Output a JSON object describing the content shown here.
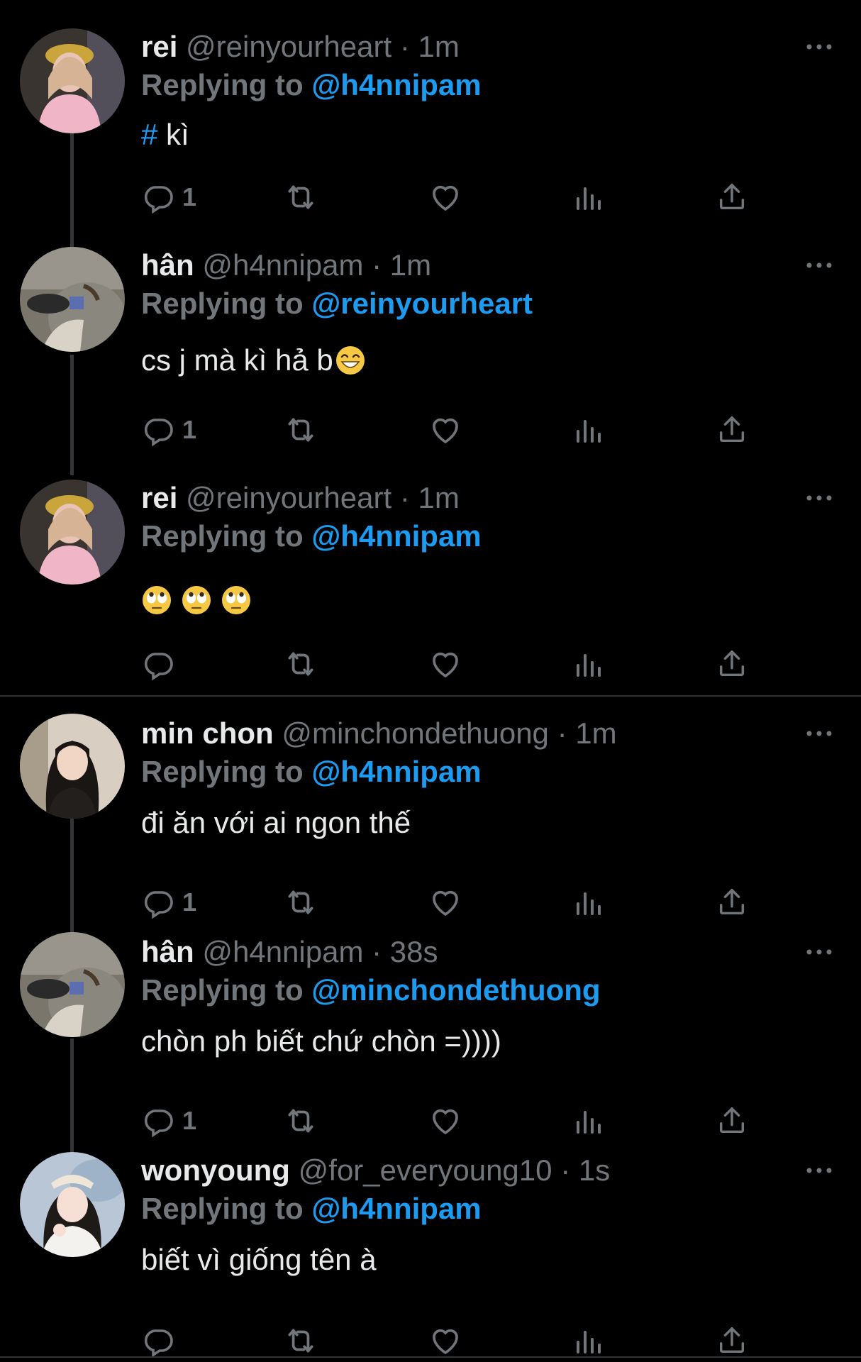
{
  "tweets": [
    {
      "name": "rei",
      "handle": "@reinyourheart",
      "time": "1m",
      "reply_prefix": "Replying to",
      "reply_to": "@h4nnipam",
      "hashtag": "#",
      "text": "kì",
      "reply_count": "1",
      "avatar": "rei-avatar"
    },
    {
      "name": "hân",
      "handle": "@h4nnipam",
      "time": "1m",
      "reply_prefix": "Replying to",
      "reply_to": "@reinyourheart",
      "text": "cs j mà kì hả b",
      "reply_count": "1",
      "avatar": "han-avatar",
      "emoji": "grinning-face"
    },
    {
      "name": "rei",
      "handle": "@reinyourheart",
      "time": "1m",
      "reply_prefix": "Replying to",
      "reply_to": "@h4nnipam",
      "text": "",
      "reply_count": "",
      "avatar": "rei-avatar",
      "emoji": "rolling-eyes x3"
    },
    {
      "name": "min chon",
      "handle": "@minchondethuong",
      "time": "1m",
      "reply_prefix": "Replying to",
      "reply_to": "@h4nnipam",
      "text": "đi ăn với ai ngon thế",
      "reply_count": "1",
      "avatar": "minchon-avatar"
    },
    {
      "name": "hân",
      "handle": "@h4nnipam",
      "time": "38s",
      "reply_prefix": "Replying to",
      "reply_to": "@minchondethuong",
      "text": "chòn ph biết chứ chòn =))))",
      "reply_count": "1",
      "avatar": "han-avatar"
    },
    {
      "name": "wonyoung",
      "handle": "@for_everyoung10",
      "time": "1s",
      "reply_prefix": "Replying to",
      "reply_to": "@h4nnipam",
      "text": "biết vì giống tên à",
      "reply_count": "",
      "avatar": "wonyoung-avatar"
    }
  ],
  "dot": "·",
  "colors": {
    "background": "#000000",
    "text": "#e7e9ea",
    "muted": "#71767b",
    "accent": "#1d9bf0",
    "divider": "#2f3336"
  },
  "action_icons": [
    "reply-icon",
    "retweet-icon",
    "like-icon",
    "analytics-icon",
    "share-icon"
  ]
}
